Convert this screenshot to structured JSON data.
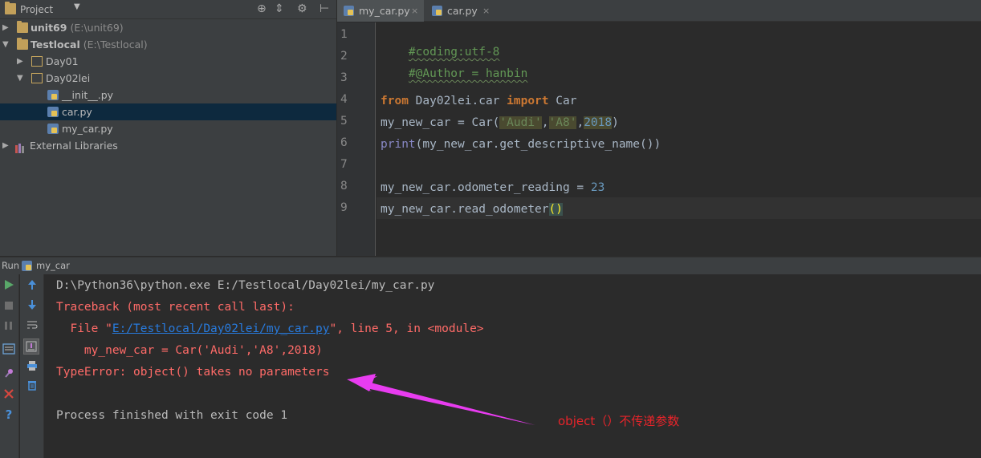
{
  "project_panel": {
    "title": "Project",
    "dropdown": "▼",
    "tools": [
      "⊕",
      "⇕",
      "⚙",
      "⊢"
    ],
    "tree": [
      {
        "label": "unit69",
        "path": "(E:\\unit69)",
        "expanded": false,
        "level": 0
      },
      {
        "label": "Testlocal",
        "path": "(E:\\Testlocal)",
        "expanded": true,
        "level": 0
      },
      {
        "label": "Day01",
        "expanded": false,
        "level": 1
      },
      {
        "label": "Day02lei",
        "expanded": true,
        "level": 1
      },
      {
        "label": "__init__.py",
        "level": 2
      },
      {
        "label": "car.py",
        "level": 2,
        "selected": true
      },
      {
        "label": "my_car.py",
        "level": 2
      },
      {
        "label": "External Libraries",
        "expanded": false,
        "level": 0
      }
    ]
  },
  "editor": {
    "tabs": [
      {
        "label": "my_car.py",
        "active": true,
        "close": "×"
      },
      {
        "label": "car.py",
        "active": false,
        "close": "×"
      }
    ],
    "line_numbers": [
      "1",
      "2",
      "3",
      "4",
      "5",
      "6",
      "7",
      "8",
      "9"
    ],
    "code": {
      "l1": "#coding:utf-8",
      "l2": "#@Author = hanbin",
      "l4_from": "from",
      "l4_mod": " Day02lei.car ",
      "l4_import": "import",
      "l4_name": " Car",
      "l5_a": "my_new_car = Car(",
      "l5_s1": "'Audi'",
      "l5_c1": ",",
      "l5_s2": "'A8'",
      "l5_c2": ",",
      "l5_n": "2018",
      "l5_end": ")",
      "l6_print": "print",
      "l6_rest": "(my_new_car.get_descriptive_name())",
      "l8_a": "my_new_car.odometer_reading = ",
      "l8_n": "23",
      "l9_a": "my_new_car.read_odometer",
      "l9_b": "()"
    }
  },
  "run_panel": {
    "label": "Run",
    "config": "my_car",
    "console": {
      "cmd": "D:\\Python36\\python.exe E:/Testlocal/Day02lei/my_car.py",
      "traceback": "Traceback (most recent call last):",
      "file_prefix": "  File \"",
      "file_link": "E:/Testlocal/Day02lei/my_car.py",
      "file_suffix": "\", line 5, in <module>",
      "code_line": "    my_new_car = Car('Audi','A8',2018)",
      "error": "TypeError: object() takes no parameters",
      "exit": "Process finished with exit code 1"
    }
  },
  "annotation": {
    "text": "object（）不传递参数",
    "color": "#e8242a",
    "arrow_color": "#e83cf0"
  }
}
